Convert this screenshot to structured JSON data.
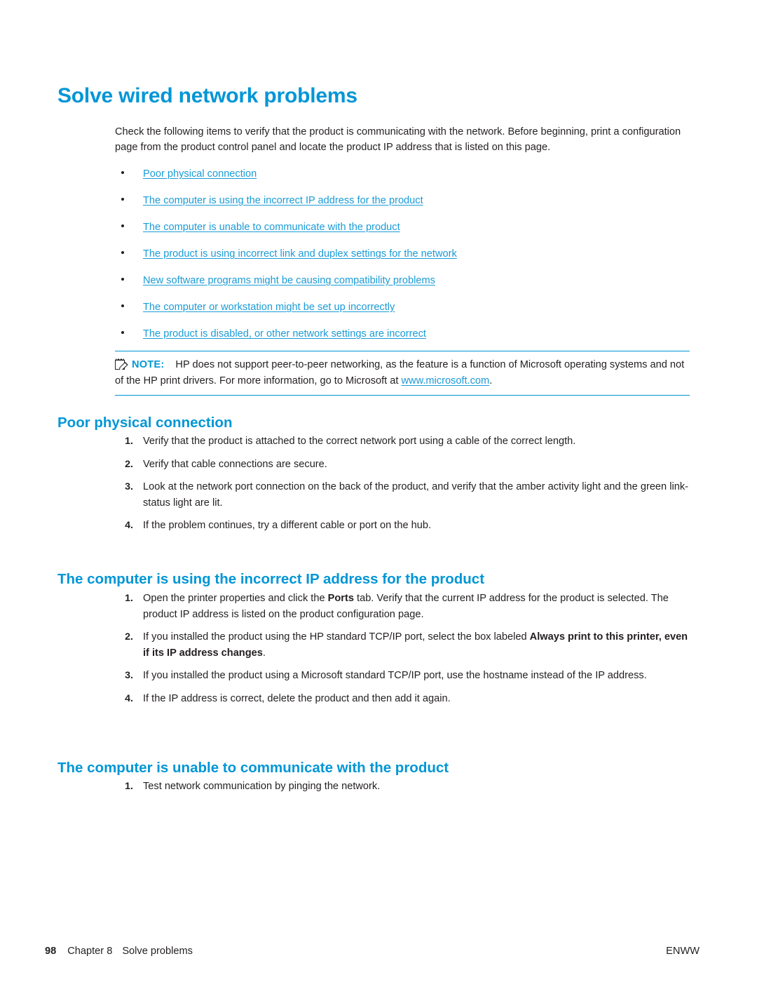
{
  "title": "Solve wired network problems",
  "intro": "Check the following items to verify that the product is communicating with the network. Before beginning, print a configuration page from the product control panel and locate the product IP address that is listed on this page.",
  "links": [
    {
      "label": "Poor physical connection"
    },
    {
      "label": "The computer is using the incorrect IP address for the product"
    },
    {
      "label": "The computer is unable to communicate with the product"
    },
    {
      "label": "The product is using incorrect link and duplex settings for the network"
    },
    {
      "label": "New software programs might be causing compatibility problems"
    },
    {
      "label": "The computer or workstation might be set up incorrectly"
    },
    {
      "label": "The product is disabled, or other network settings are incorrect"
    }
  ],
  "note": {
    "label": "NOTE:",
    "text_before_link": "HP does not support peer-to-peer networking, as the feature is a function of Microsoft operating systems and not of the HP print drivers. For more information, go to Microsoft at ",
    "link": "www.microsoft.com",
    "text_after_link": "."
  },
  "sections": [
    {
      "heading": "Poor physical connection",
      "steps": [
        {
          "num": "1.",
          "text": "Verify that the product is attached to the correct network port using a cable of the correct length."
        },
        {
          "num": "2.",
          "text": "Verify that cable connections are secure."
        },
        {
          "num": "3.",
          "text": "Look at the network port connection on the back of the product, and verify that the amber activity light and the green link-status light are lit."
        },
        {
          "num": "4.",
          "text": "If the problem continues, try a different cable or port on the hub."
        }
      ]
    },
    {
      "heading": "The computer is using the incorrect IP address for the product",
      "steps": [
        {
          "num": "1.",
          "part1": "Open the printer properties and click the ",
          "bold1": "Ports",
          "part2": " tab. Verify that the current IP address for the product is selected. The product IP address is listed on the product configuration page."
        },
        {
          "num": "2.",
          "part1": "If you installed the product using the HP standard TCP/IP port, select the box labeled ",
          "bold1": "Always print to this printer, even if its IP address changes",
          "part2": "."
        },
        {
          "num": "3.",
          "text": "If you installed the product using a Microsoft standard TCP/IP port, use the hostname instead of the IP address."
        },
        {
          "num": "4.",
          "text": "If the IP address is correct, delete the product and then add it again."
        }
      ]
    },
    {
      "heading": "The computer is unable to communicate with the product",
      "steps": [
        {
          "num": "1.",
          "text": "Test network communication by pinging the network."
        }
      ]
    }
  ],
  "footer": {
    "page_number": "98",
    "chapter": "Chapter 8",
    "chapter_title": "Solve problems",
    "right": "ENWW"
  },
  "colors": {
    "accent": "#0096d6",
    "link": "#1a9bd7",
    "text": "#231f20"
  }
}
